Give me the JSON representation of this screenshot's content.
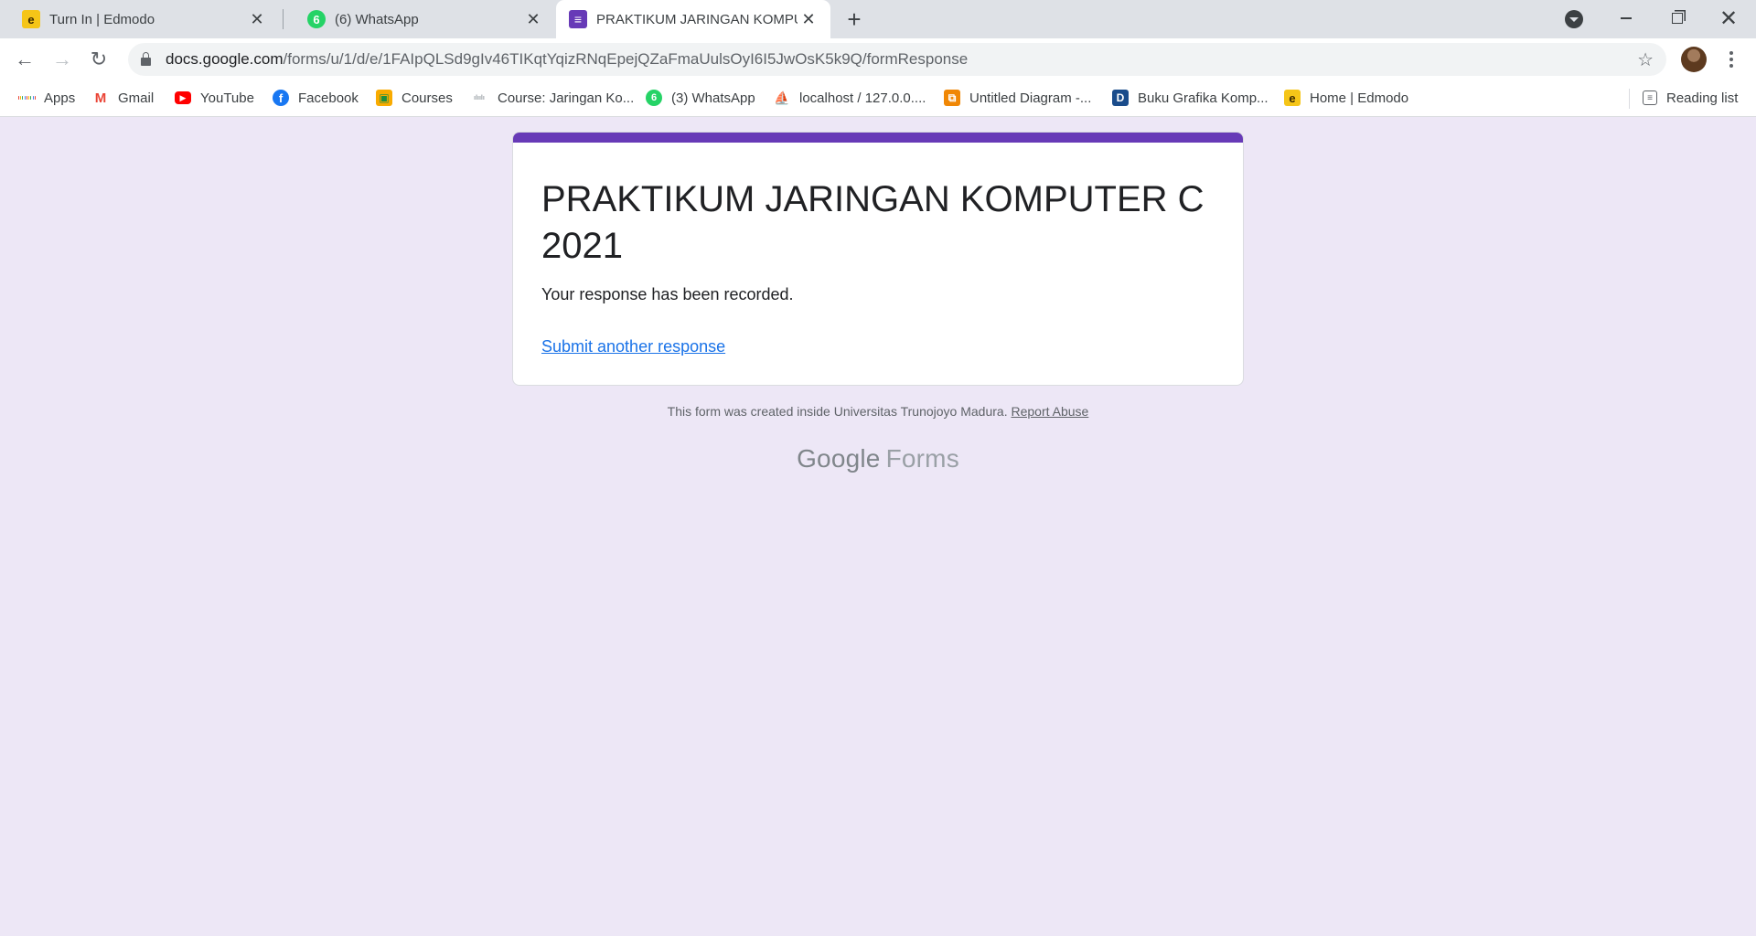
{
  "browser": {
    "tabs": [
      {
        "title": "Turn In | Edmodo",
        "icon": "edmodo-icon",
        "icon_glyph": "e",
        "active": false
      },
      {
        "title": "(6) WhatsApp",
        "icon": "whatsapp-icon",
        "icon_glyph": "6",
        "active": false
      },
      {
        "title": "PRAKTIKUM JARINGAN KOMPUTER C 2021",
        "icon": "google-forms-icon",
        "icon_glyph": "≡",
        "active": true
      }
    ],
    "new_tab_glyph": "+",
    "close_glyph": "✕",
    "window_close_glyph": "✕",
    "address": {
      "host": "docs.google.com",
      "path": "/forms/u/1/d/e/1FAIpQLSd9gIv46TIKqtYqizRNqEpejQZaFmaUulsOyI6I5JwOsK5k9Q/formResponse"
    },
    "nav": {
      "back": "←",
      "forward": "→",
      "reload": "↻",
      "star": "☆"
    },
    "bookmarks": [
      {
        "label": "Apps",
        "icon": "apps-grid-icon"
      },
      {
        "label": "Gmail",
        "icon": "gmail-icon",
        "glyph": "M"
      },
      {
        "label": "YouTube",
        "icon": "youtube-icon",
        "glyph": "▶"
      },
      {
        "label": "Facebook",
        "icon": "facebook-icon",
        "glyph": "f"
      },
      {
        "label": "Courses",
        "icon": "classroom-icon",
        "glyph": "▣"
      },
      {
        "label": "Course: Jaringan Ko...",
        "icon": "cisco-icon",
        "glyph": "ılıılı"
      },
      {
        "label": "(3) WhatsApp",
        "icon": "whatsapp-icon",
        "glyph": "6"
      },
      {
        "label": "localhost / 127.0.0....",
        "icon": "phpmyadmin-icon",
        "glyph": "⛵"
      },
      {
        "label": "Untitled Diagram -...",
        "icon": "drawio-icon",
        "glyph": "⧉"
      },
      {
        "label": "Buku Grafika Komp...",
        "icon": "book-icon",
        "glyph": "D"
      },
      {
        "label": "Home | Edmodo",
        "icon": "edmodo-icon",
        "glyph": "e"
      }
    ],
    "reading_list": "Reading list"
  },
  "form": {
    "title": "PRAKTIKUM JARINGAN KOMPUTER C 2021",
    "confirmation": "Your response has been recorded.",
    "another_link": "Submit another response",
    "footer_text": "This form was created inside Universitas Trunojoyo Madura.",
    "report_link": "Report Abuse",
    "brand_google": "Google",
    "brand_forms": "Forms"
  },
  "colors": {
    "accent": "#673ab7",
    "page_background": "#ede7f6",
    "link": "#1a73e8"
  }
}
